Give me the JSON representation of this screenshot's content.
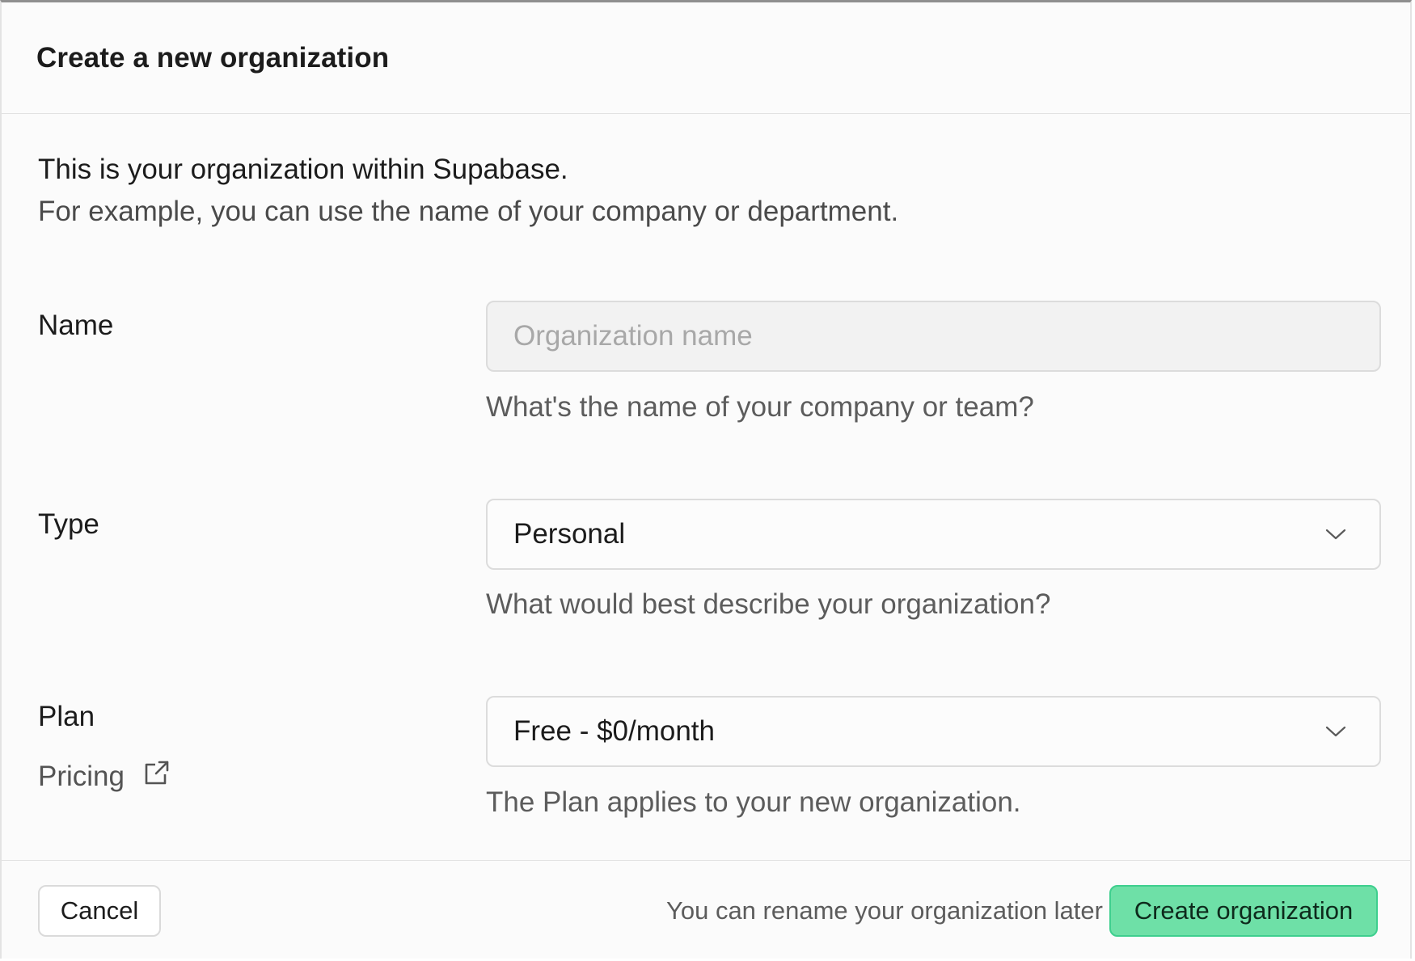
{
  "dialog": {
    "title": "Create a new organization",
    "intro_title": "This is your organization within Supabase.",
    "intro_subtitle": "For example, you can use the name of your company or department."
  },
  "fields": {
    "name": {
      "label": "Name",
      "value": "",
      "placeholder": "Organization name",
      "hint": "What's the name of your company or team?"
    },
    "type": {
      "label": "Type",
      "selected": "Personal",
      "hint": "What would best describe your organization?"
    },
    "plan": {
      "label": "Plan",
      "link_label": "Pricing",
      "link_icon": "external-link-icon",
      "selected": "Free - $0/month",
      "hint": "The Plan applies to your new organization."
    }
  },
  "footer": {
    "cancel_label": "Cancel",
    "note": "You can rename your organization later",
    "create_label": "Create organization"
  },
  "colors": {
    "accent": "#6ee0a7",
    "accent_border": "#3ecf8e"
  }
}
